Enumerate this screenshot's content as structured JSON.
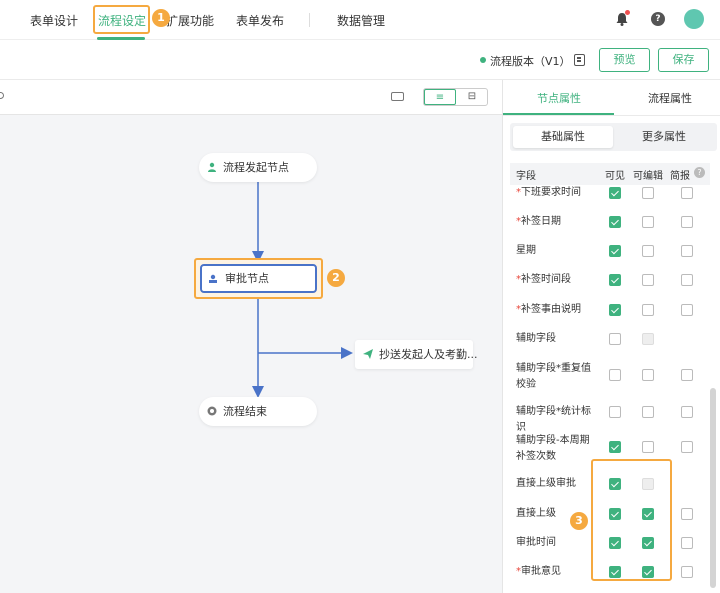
{
  "nav": {
    "items": [
      "表单设计",
      "流程设定",
      "扩展功能",
      "表单发布",
      "数据管理"
    ],
    "active": "流程设定"
  },
  "badges": [
    "1",
    "2",
    "3"
  ],
  "toolbar": {
    "version": "流程版本（V1）",
    "preview": "预览",
    "save": "保存"
  },
  "flow": {
    "start": "流程发起节点",
    "approve": "审批节点",
    "cc": "抄送发起人及考勤...",
    "end": "流程结束"
  },
  "panel": {
    "tabs": [
      "节点属性",
      "流程属性"
    ],
    "subtabs": [
      "基础属性",
      "更多属性"
    ],
    "headers": [
      "字段",
      "可见",
      "可编辑",
      "简报"
    ],
    "rows": [
      {
        "label": "下班要求时间",
        "required": true,
        "visible": true,
        "editable": false,
        "brief": false
      },
      {
        "label": "补签日期",
        "required": true,
        "visible": true,
        "editable": false,
        "brief": false
      },
      {
        "label": "星期",
        "required": false,
        "visible": true,
        "editable": false,
        "brief": false
      },
      {
        "label": "补签时间段",
        "required": true,
        "visible": true,
        "editable": false,
        "brief": false
      },
      {
        "label": "补签事由说明",
        "required": true,
        "visible": true,
        "editable": false,
        "brief": false
      },
      {
        "label": "辅助字段",
        "required": false,
        "visible": false,
        "editable": "disabled",
        "brief": null
      },
      {
        "label": "辅助字段*重复值校验",
        "required": false,
        "visible": false,
        "editable": false,
        "brief": false
      },
      {
        "label": "辅助字段*统计标识",
        "required": false,
        "visible": false,
        "editable": false,
        "brief": false
      },
      {
        "label": "辅助字段-本周期补签次数",
        "required": false,
        "visible": true,
        "editable": false,
        "brief": false
      },
      {
        "label": "直接上级审批",
        "required": false,
        "visible": true,
        "editable": "disabled",
        "brief": null
      },
      {
        "label": "直接上级",
        "required": false,
        "visible": true,
        "editable": true,
        "brief": false
      },
      {
        "label": "审批时间",
        "required": false,
        "visible": true,
        "editable": true,
        "brief": false
      },
      {
        "label": "审批意见",
        "required": true,
        "visible": true,
        "editable": true,
        "brief": false
      }
    ]
  },
  "colors": {
    "accent": "#3fb27f",
    "highlight": "#f5a940",
    "node_border": "#4a73c8",
    "arrow": "#4a73c8"
  }
}
